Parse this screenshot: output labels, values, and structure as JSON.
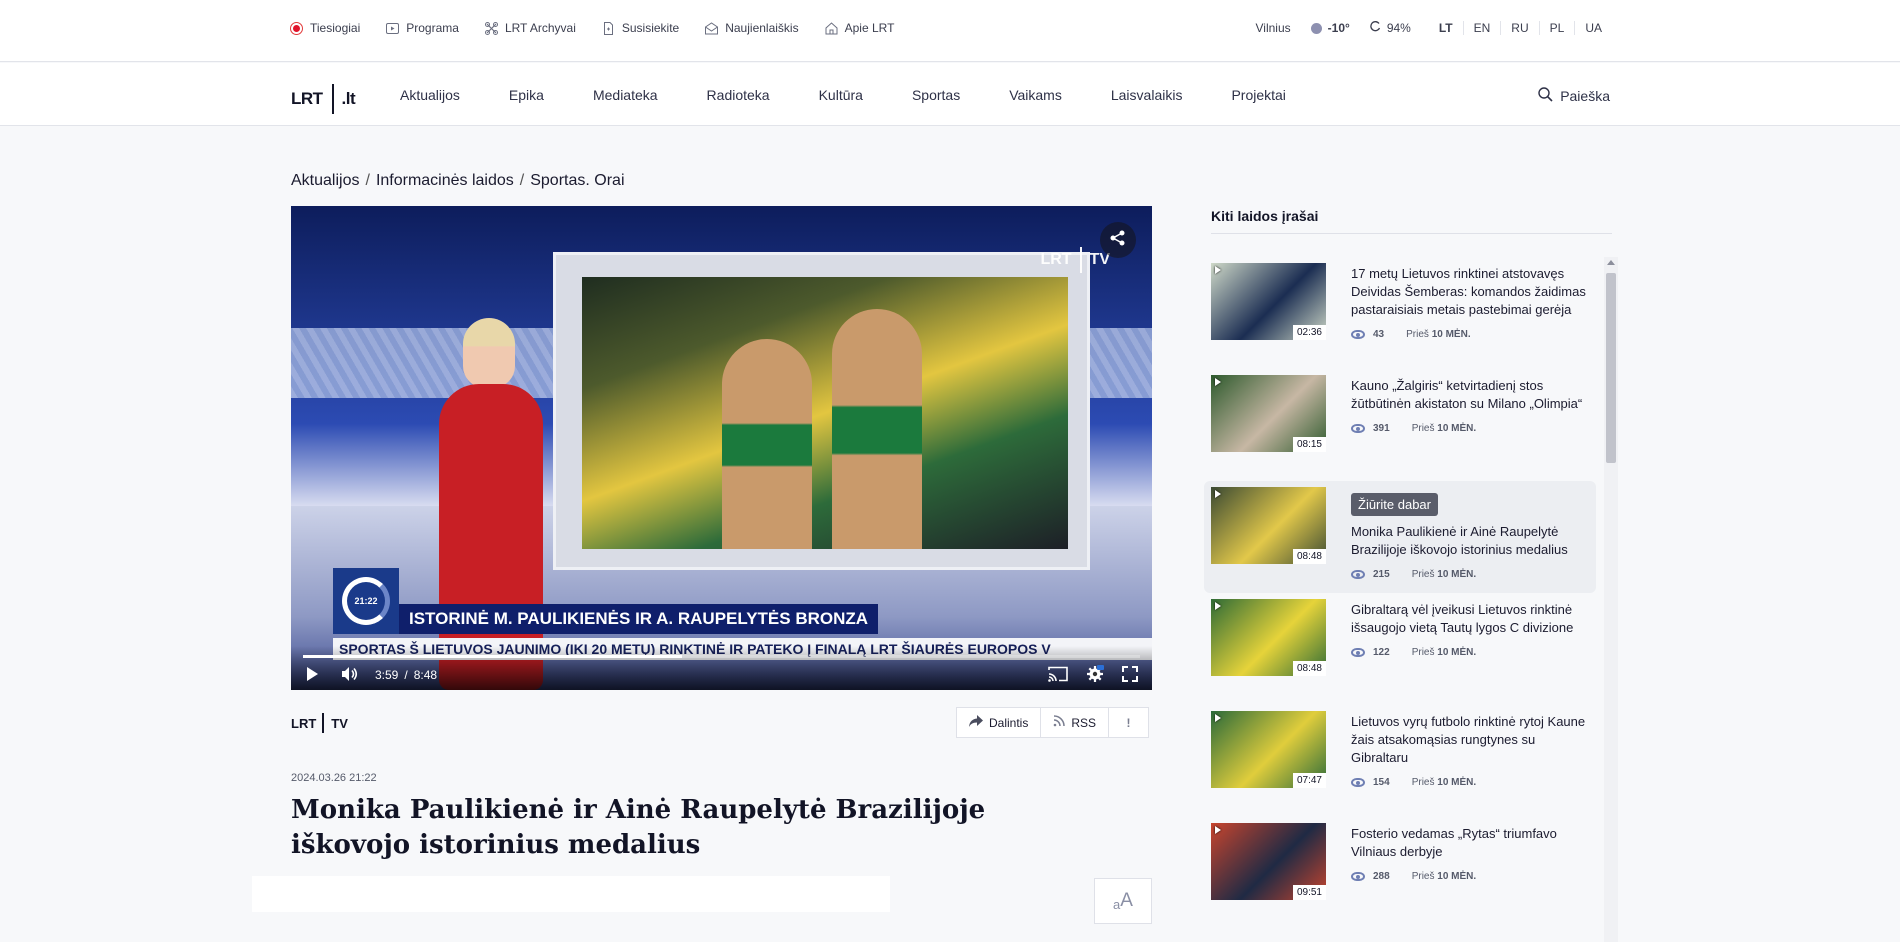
{
  "topbar": {
    "items": [
      {
        "label": "Tiesiogiai",
        "icon": "live-dot-icon"
      },
      {
        "label": "Programa",
        "icon": "play-square-icon"
      },
      {
        "label": "LRT Archyvai",
        "icon": "archive-icon"
      },
      {
        "label": "Susisiekite",
        "icon": "document-icon"
      },
      {
        "label": "Naujienlaiškis",
        "icon": "envelope-icon"
      },
      {
        "label": "Apie LRT",
        "icon": "home-icon"
      }
    ],
    "city": "Vilnius",
    "temperature": "-10°",
    "humidity": "94%",
    "languages": [
      "LT",
      "EN",
      "RU",
      "PL",
      "UA"
    ]
  },
  "nav": {
    "logo_left": "LRT",
    "logo_right": ".lt",
    "items": [
      "Aktualijos",
      "Epika",
      "Mediateka",
      "Radioteka",
      "Kultūra",
      "Sportas",
      "Vaikams",
      "Laisvalaikis",
      "Projektai"
    ],
    "search_label": "Paieška"
  },
  "breadcrumb": [
    "Aktualijos",
    "Informacinės laidos",
    "Sportas. Orai"
  ],
  "player": {
    "watermark_left": "LRT",
    "watermark_right": "TV",
    "clock": "21:22",
    "lower_third": "ISTORINĖ M. PAULIKIENĖS IR A. RAUPELYTĖS BRONZA",
    "ticker": "SPORTAS  Š LIETUVOS JAUNIMO (IKI 20 METŲ) RINKTINĖ IR PATEKO Į FINALĄ  LRT  ŠIAURĖS EUROPOS V",
    "current_time": "3:59",
    "separator": "/",
    "duration": "8:48",
    "progress": 0.453
  },
  "source": {
    "left": "LRT",
    "right": "TV"
  },
  "actions": {
    "share": "Dalintis",
    "rss": "RSS",
    "report": "!"
  },
  "article": {
    "date": "2024.03.26 21:22",
    "title": "Monika Paulikienė ir Ainė Raupelytė Brazilijoje iškovojo istorinius medalius",
    "font_small": "a",
    "font_big": "A"
  },
  "sidebar": {
    "title": "Kiti laidos įrašai",
    "watch_now": "Žiūrite dabar",
    "ago_prefix": "Prieš",
    "items": [
      {
        "title": "17 metų Lietuvos rinktinei atstovavęs Deividas Šemberas: komandos žaidimas pastaraisiais metais pastebimai gerėja",
        "duration": "02:36",
        "views": "43",
        "ago": "10 MĖN.",
        "active": false,
        "thumb_colors": [
          "#cfd9c8",
          "#1b2d52"
        ]
      },
      {
        "title": "Kauno „Žalgiris“ ketvirtadienį stos žūtbūtinėn akistaton su Milano „Olimpia“",
        "duration": "08:15",
        "views": "391",
        "ago": "10 MĖN.",
        "active": false,
        "thumb_colors": [
          "#2e5a2d",
          "#c7b7a4"
        ]
      },
      {
        "title": "Monika Paulikienė ir Ainė Raupelytė Brazilijoje iškovojo istorinius medalius",
        "duration": "08:48",
        "views": "215",
        "ago": "10 MĖN.",
        "active": true,
        "thumb_colors": [
          "#3b4a33",
          "#e2c84a"
        ]
      },
      {
        "title": "Gibraltarą vėl įveikusi Lietuvos rinktinė išsaugojo vietą Tautų lygos C divizione",
        "duration": "08:48",
        "views": "122",
        "ago": "10 MĖN.",
        "active": false,
        "thumb_colors": [
          "#2f6b36",
          "#e6d33a"
        ]
      },
      {
        "title": "Lietuvos vyrų futbolo rinktinė rytoj Kaune žais atsakomąsias rungtynes su Gibraltaru",
        "duration": "07:47",
        "views": "154",
        "ago": "10 MĖN.",
        "active": false,
        "thumb_colors": [
          "#2b6a3a",
          "#e0cd3c"
        ]
      },
      {
        "title": "Fosterio vedamas „Rytas“ triumfavo Vilniaus derbyje",
        "duration": "09:51",
        "views": "288",
        "ago": "10 MĖN.",
        "active": false,
        "thumb_colors": [
          "#c8452e",
          "#1f2a44"
        ]
      }
    ]
  }
}
